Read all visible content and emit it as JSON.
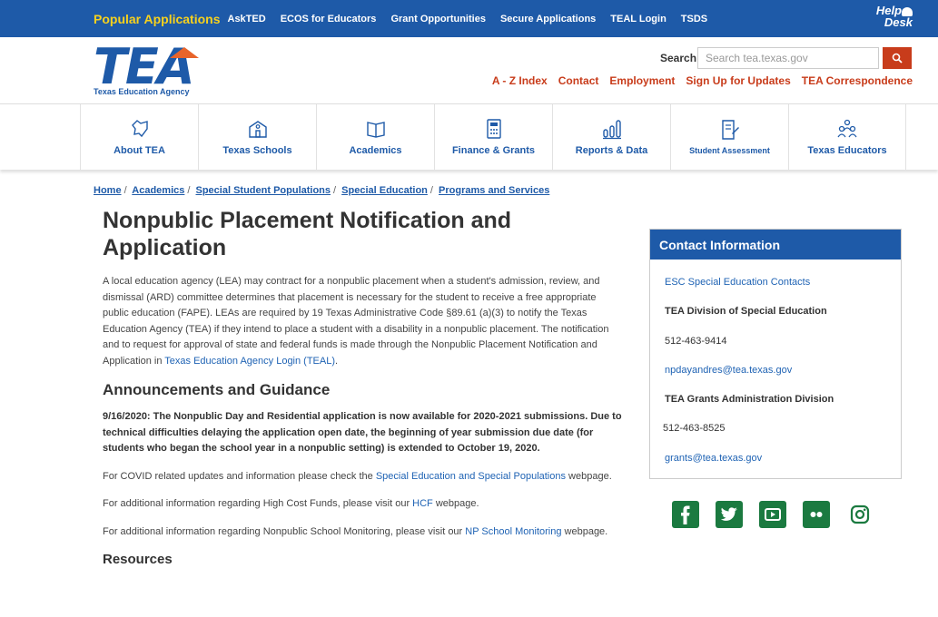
{
  "topbar": {
    "popular_label": "Popular Applications",
    "links": [
      "AskTED",
      "ECOS for Educators",
      "Grant Opportunities",
      "Secure Applications",
      "TEAL Login",
      "TSDS"
    ],
    "helpdesk_line1": "Help",
    "helpdesk_line2": "Desk"
  },
  "header": {
    "logo_text": "TEA",
    "logo_sub": "Texas Education Agency",
    "search_label": "Search",
    "search_placeholder": "Search tea.texas.gov",
    "util_links": [
      "A - Z Index",
      "Contact",
      "Employment",
      "Sign Up for Updates",
      "TEA Correspondence"
    ]
  },
  "nav": {
    "items": [
      {
        "label": "About TEA",
        "icon": "map-icon"
      },
      {
        "label": "Texas Schools",
        "icon": "school-icon"
      },
      {
        "label": "Academics",
        "icon": "book-icon"
      },
      {
        "label": "Finance & Grants",
        "icon": "calculator-icon"
      },
      {
        "label": "Reports & Data",
        "icon": "bar-chart-icon"
      },
      {
        "label": "Student Assessment",
        "icon": "test-icon"
      },
      {
        "label": "Texas Educators",
        "icon": "people-icon"
      }
    ]
  },
  "breadcrumb": [
    "Home",
    "Academics",
    "Special Student Populations",
    "Special Education",
    "Programs and Services"
  ],
  "main": {
    "title": "Nonpublic Placement Notification and Application",
    "intro": "A local education agency (LEA) may contract for a nonpublic placement when a student's admission, review, and dismissal (ARD) committee determines that placement is necessary for the student to receive a free appropriate public education (FAPE). LEAs are required by 19 Texas Administrative Code §89.61 (a)(3) to notify the Texas Education Agency (TEA) if they intend to place a student with a disability in a nonpublic placement. The notification and to request for approval of state and federal funds is made through the Nonpublic Placement Notification and Application in ",
    "intro_link": "Texas Education Agency Login (TEAL)",
    "intro_end": ".",
    "announcements_heading": "Announcements and Guidance",
    "announcement_bold": "9/16/2020: The Nonpublic Day and Residential application is now available for 2020-2021 submissions. Due to technical difficulties delaying the application open date, the beginning of year submission due date (for students who began the school year in a nonpublic setting) is extended to October 19, 2020.",
    "covid_pre": "For COVID related updates and information please check the ",
    "covid_link": "Special Education and Special Populations",
    "covid_post": " webpage.",
    "hcf_pre": "For additional information regarding High Cost Funds, please visit our ",
    "hcf_link": "HCF",
    "hcf_post": " webpage.",
    "np_pre": "For additional information regarding Nonpublic School Monitoring, please visit our ",
    "np_link": "NP School Monitoring",
    "np_post": " webpage.",
    "resources_heading": "Resources"
  },
  "contact": {
    "heading": "Contact Information",
    "esc_link": "ESC Special Education Contacts",
    "division1": "TEA Division of Special Education",
    "phone1": "512-463-9414",
    "email1": "npdayandres@tea.texas.gov",
    "division2": "TEA Grants Administration Division",
    "phone2": "512-463-8525",
    "email2": "grants@tea.texas.gov"
  },
  "social": [
    "facebook-icon",
    "twitter-icon",
    "youtube-icon",
    "flickr-icon",
    "instagram-icon"
  ],
  "colors": {
    "brand_blue": "#1e5aa8",
    "accent_red": "#c83c1b",
    "accent_yellow": "#f7d11d",
    "social_green": "#1b7a40"
  }
}
